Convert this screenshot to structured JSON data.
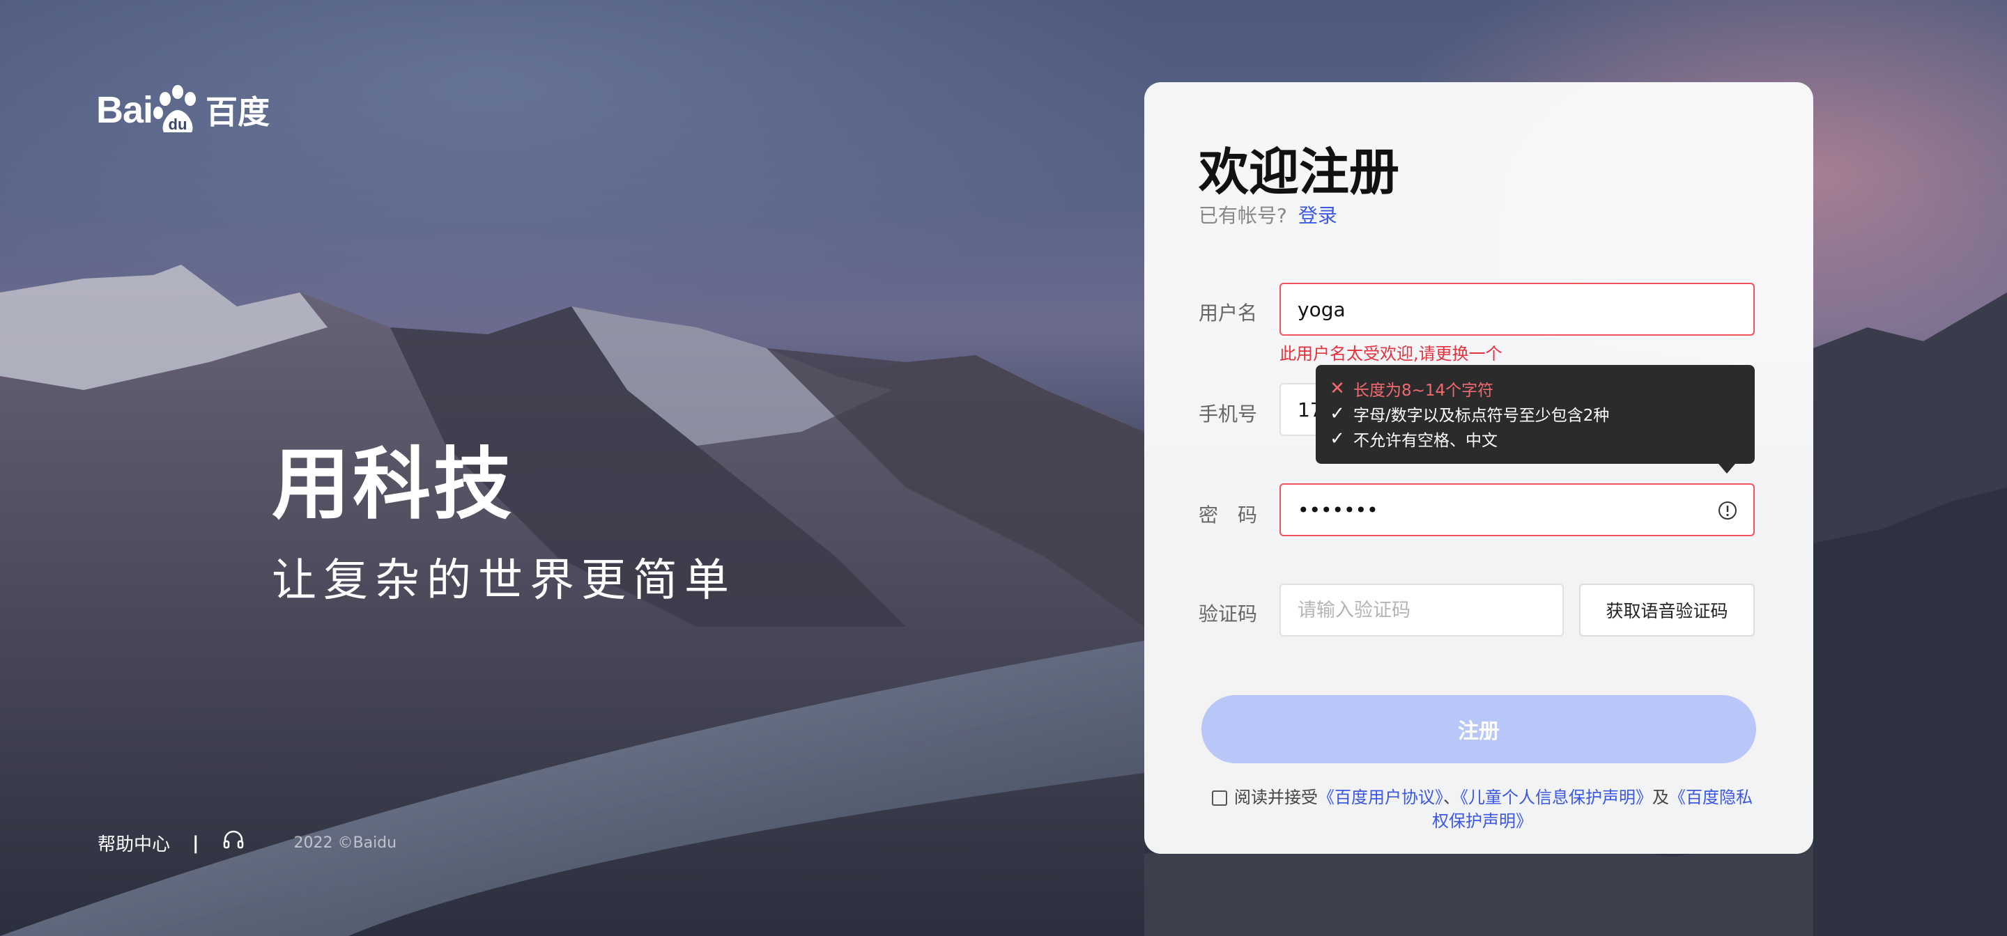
{
  "brand": {
    "logo_left": "Bai",
    "logo_right": "du",
    "logo_cn": "百度"
  },
  "slogan": {
    "title": "用科技",
    "subtitle": "让复杂的世界更简单"
  },
  "footer": {
    "help": "帮助中心",
    "separator": "|",
    "copyright": "2022 ©Baidu",
    "icon": "headset-icon"
  },
  "form": {
    "title": "欢迎注册",
    "have_account": "已有帐号?",
    "login_link": "登录",
    "username": {
      "label": "用户名",
      "value": "yoga",
      "error": "此用户名太受欢迎,请更换一个"
    },
    "phone": {
      "label": "手机号",
      "value": "1727"
    },
    "password": {
      "label": "密　码",
      "value": "•••••••",
      "icon": "info-circle-icon"
    },
    "password_rules": [
      {
        "text": "长度为8~14个字符",
        "status": "fail"
      },
      {
        "text": "字母/数字以及标点符号至少包含2种",
        "status": "pass"
      },
      {
        "text": "不允许有空格、中文",
        "status": "pass"
      }
    ],
    "code": {
      "label": "验证码",
      "placeholder": "请输入验证码",
      "button": "获取语音验证码"
    },
    "submit": "注册",
    "agreement": {
      "prefix": "阅读并接受",
      "link1": "《百度用户协议》",
      "sep1": "、",
      "link2": "《儿童个人信息保护声明》",
      "sep2": "及",
      "link3": "《百度隐私权保护声明》"
    }
  },
  "colors": {
    "accent": "#3b57e6",
    "error": "#e6323c",
    "submit_disabled": "#b9c6f8",
    "tooltip_bg": "#2b2b2b"
  }
}
